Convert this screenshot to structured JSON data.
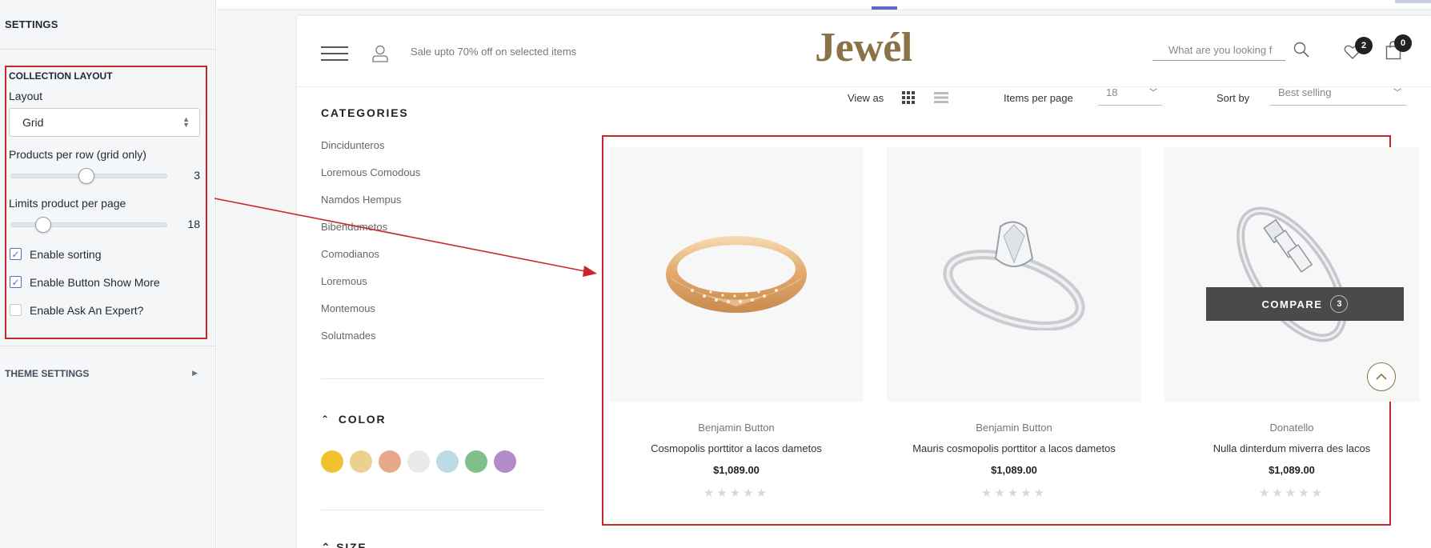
{
  "settings": {
    "header": "SETTINGS",
    "collection_layout": {
      "title": "COLLECTION LAYOUT",
      "layout_label": "Layout",
      "layout_value": "Grid",
      "products_per_row_label": "Products per row (grid only)",
      "products_per_row_value": "3",
      "limits_label": "Limits product per page",
      "limits_value": "18",
      "enable_sorting": {
        "label": "Enable sorting",
        "checked": true
      },
      "enable_show_more": {
        "label": "Enable Button Show More",
        "checked": true
      },
      "enable_ask_expert": {
        "label": "Enable Ask An Expert?",
        "checked": false
      }
    },
    "theme_settings": "THEME SETTINGS"
  },
  "store": {
    "promo": "Sale upto 70% off on selected items",
    "logo": "Jewél",
    "search_placeholder": "What are you looking for?",
    "wishlist_count": "2",
    "cart_count": "0",
    "categories_title": "CATEGORIES",
    "categories": [
      "Dincidunteros",
      "Loremous Comodous",
      "Namdos Hempus",
      "Bibendumetos",
      "Comodianos",
      "Loremous",
      "Montemous",
      "Solutmades"
    ],
    "color_title": "COLOR",
    "colors": [
      "#f0c22d",
      "#ecd08f",
      "#e8a98a",
      "#e9e9e9",
      "#bcdbe6",
      "#7ebf8a",
      "#b18cc8"
    ],
    "size_title": "SIZE",
    "toolbar": {
      "view_as": "View as",
      "items_per_page_label": "Items per page",
      "items_per_page_value": "18",
      "sort_by_label": "Sort by",
      "sort_by_value": "Best selling"
    },
    "products": [
      {
        "vendor": "Benjamin Button",
        "title": "Cosmopolis porttitor a lacos dametos",
        "price": "$1,089.00",
        "image": "gold-ring"
      },
      {
        "vendor": "Benjamin Button",
        "title": "Mauris cosmopolis porttitor a lacos dametos",
        "price": "$1,089.00",
        "image": "diamond-ring"
      },
      {
        "vendor": "Donatello",
        "title": "Nulla dinterdum miverra des lacos",
        "price": "$1,089.00",
        "image": "baguette-ring"
      }
    ],
    "compare": {
      "label": "COMPARE",
      "count": "3"
    },
    "stars": "★★★★★"
  },
  "colors": {
    "annotation": "#c8282d",
    "brand": "#8a7246",
    "accent": "#5c6ac4"
  }
}
